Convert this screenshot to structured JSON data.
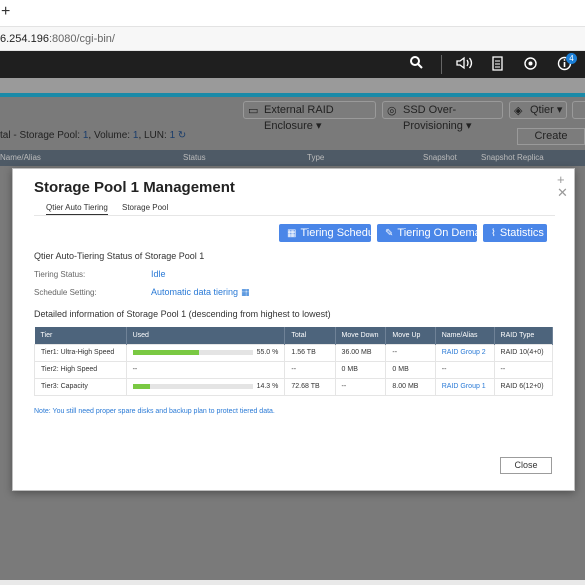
{
  "browser": {
    "new_tab": "+",
    "url_host": "6.254.196",
    "url_rest": ":8080/cgi-bin/"
  },
  "topbar": {
    "icons": [
      "search-icon",
      "volume-icon",
      "notes-icon",
      "sync-icon",
      "info-icon"
    ],
    "notification_count": "4"
  },
  "toolbar": {
    "external_raid": "External RAID Enclosure",
    "ssd_overprovisioning": "SSD Over-Provisioning",
    "qtier": "Qtier"
  },
  "summary": {
    "prefix": "tal - Storage Pool:",
    "pool_count": "1",
    "volume_label": ", Volume:",
    "volume_count": "1",
    "lun_label": ", LUN:",
    "lun_count": "1",
    "create": "Create"
  },
  "columns": [
    "Name/Alias",
    "Status",
    "Type",
    "Snapshot",
    "Snapshot Replica"
  ],
  "dialog": {
    "title": "Storage Pool 1 Management",
    "tabs": [
      "Qtier Auto Tiering",
      "Storage Pool"
    ],
    "buttons": {
      "tiering_schedule": "Tiering Schedule",
      "tiering_on_demand": "Tiering On Demand",
      "statistics": "Statistics"
    },
    "status_title": "Qtier Auto-Tiering Status of Storage Pool 1",
    "tiering_status_label": "Tiering Status:",
    "tiering_status_value": "Idle",
    "schedule_label": "Schedule Setting:",
    "schedule_value": "Automatic data tiering",
    "detail_title": "Detailed information of Storage Pool 1 (descending from highest to lowest)",
    "table": {
      "headers": [
        "Tier",
        "Used",
        "Total",
        "Move Down",
        "Move Up",
        "Name/Alias",
        "RAID Type"
      ],
      "rows": [
        {
          "tier": "Tier1: Ultra-High Speed",
          "used_pct": 55.0,
          "used_text": "55.0 %",
          "total": "1.56 TB",
          "move_down": "36.00 MB",
          "move_up": "--",
          "alias": "RAID Group 2",
          "raid": "RAID 10(4+0)"
        },
        {
          "tier": "Tier2: High Speed",
          "used_pct": null,
          "used_text": "--",
          "total": "--",
          "move_down": "0 MB",
          "move_up": "0 MB",
          "alias": "--",
          "raid": "--"
        },
        {
          "tier": "Tier3: Capacity",
          "used_pct": 14.3,
          "used_text": "14.3 %",
          "total": "72.68 TB",
          "move_down": "--",
          "move_up": "8.00 MB",
          "alias": "RAID Group 1",
          "raid": "RAID 6(12+0)"
        }
      ]
    },
    "note": "Note: You still need proper spare disks and backup plan to protect tiered data.",
    "close": "Close"
  },
  "colors": {
    "accent": "#4a86e8",
    "link": "#2a7ad6",
    "table_header": "#4d647c",
    "bar_fill": "#7ac943"
  }
}
